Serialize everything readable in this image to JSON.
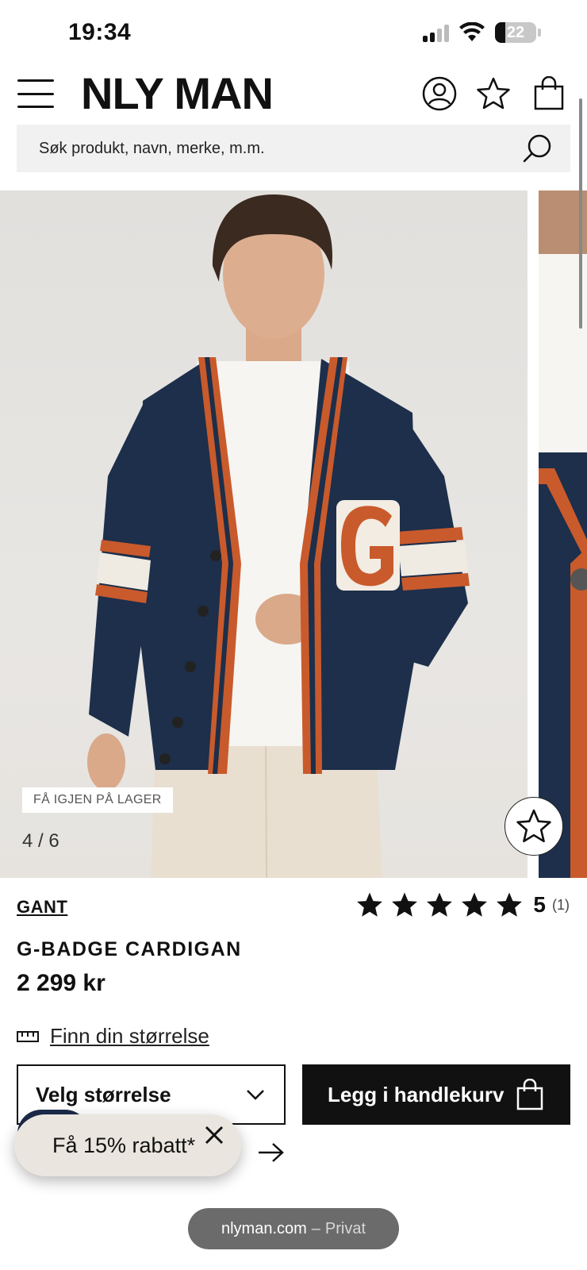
{
  "status_bar": {
    "time": "19:34",
    "battery_level": "22",
    "icons": [
      "cellular-signal-icon",
      "wifi-icon",
      "battery-icon"
    ]
  },
  "header": {
    "logo": "NLY MAN",
    "icons": [
      "menu-icon",
      "account-icon",
      "wishlist-star-icon",
      "shopping-bag-icon"
    ]
  },
  "search": {
    "placeholder": "Søk produkt, navn, merke, m.m."
  },
  "gallery": {
    "badge": "FÅ IGJEN PÅ LAGER",
    "counter": "4 / 6"
  },
  "product": {
    "brand": "GANT",
    "name": "G-BADGE CARDIGAN",
    "price": "2 299 kr",
    "rating_value": "5",
    "rating_count": "(1)",
    "rating_stars": 5
  },
  "size_guide": {
    "label": "Finn din størrelse"
  },
  "actions": {
    "size_select_label": "Velg størrelse",
    "add_to_cart_label": "Legg i handlekurv"
  },
  "promo": {
    "label": "Få 15% rabatt*"
  },
  "browser": {
    "domain": "nlyman.com",
    "separator": "–",
    "mode": "Privat"
  },
  "colors": {
    "accent": "#111111",
    "cardigan_navy": "#1d2f4a",
    "cardigan_orange": "#c95a2c",
    "promo_bg": "#eae6df"
  }
}
